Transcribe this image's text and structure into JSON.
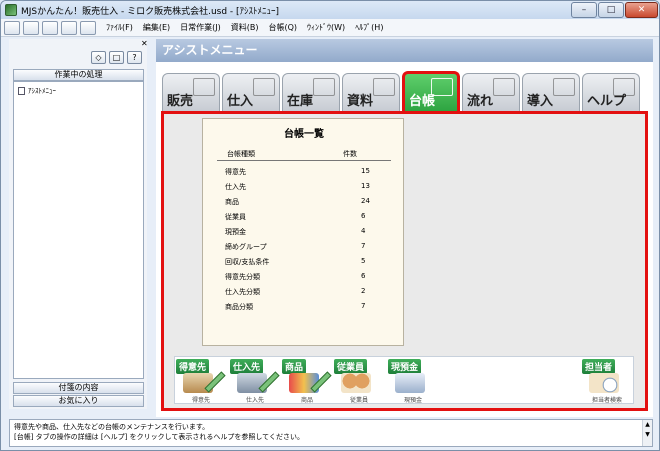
{
  "window": {
    "title": "MJSかんたん！販売仕入 - ミロク販売株式会社.usd - [ｱｼｽﾄﾒﾆｭｰ]",
    "min": "–",
    "max": "□",
    "close": "✕"
  },
  "menubar": {
    "items": [
      "ﾌｧｲﾙ(F)",
      "編集(E)",
      "日常作業(J)",
      "資料(B)",
      "台帳(Q)",
      "ｳｨﾝﾄﾞｳ(W)",
      "ﾍﾙﾌﾟ(H)"
    ],
    "mdi": [
      "_",
      "▫",
      "✕"
    ]
  },
  "left_panel": {
    "close": "✕",
    "tools": [
      "◇",
      "□",
      "?"
    ],
    "header": "作業中の処理",
    "tree_item": "ｱｼｽﾄﾒﾆｭｰ",
    "footer1": "付箋の内容",
    "footer2": "お気に入り"
  },
  "main": {
    "title": "アシストメニュー"
  },
  "tabs": [
    {
      "label": "販売"
    },
    {
      "label": "仕入"
    },
    {
      "label": "在庫"
    },
    {
      "label": "資料"
    },
    {
      "label": "台帳"
    },
    {
      "label": "流れ"
    },
    {
      "label": "導入"
    },
    {
      "label": "ヘルプ"
    }
  ],
  "ledger": {
    "title": "台帳一覧",
    "col_name": "台帳種類",
    "col_count": "件数",
    "rows": [
      {
        "name": "得意先",
        "count": "15"
      },
      {
        "name": "仕入先",
        "count": "13"
      },
      {
        "name": "商品",
        "count": "24"
      },
      {
        "name": "従業員",
        "count": "6"
      },
      {
        "name": "現預金",
        "count": "4"
      },
      {
        "name": "締めグループ",
        "count": "7"
      },
      {
        "name": "回収/支払条件",
        "count": "5"
      },
      {
        "name": "得意先分類",
        "count": "6"
      },
      {
        "name": "仕入先分類",
        "count": "2"
      },
      {
        "name": "商品分類",
        "count": "7"
      }
    ]
  },
  "bottom": {
    "items": [
      {
        "label": "得意先",
        "caption": "得意先"
      },
      {
        "label": "仕入先",
        "caption": "仕入先"
      },
      {
        "label": "商品",
        "caption": "商品"
      },
      {
        "label": "従業員",
        "caption": "従業員"
      },
      {
        "label": "現預金",
        "caption": "現預金"
      },
      {
        "label": "担当者",
        "caption": "担当者検索"
      }
    ]
  },
  "status": {
    "line1": "得意先や商品、仕入先などの台帳のメンテナンスを行います。",
    "line2": "[台帳] タブの操作の詳細は [ヘルプ] をクリックして表示されるヘルプを参照してください。"
  },
  "colors": {
    "active_tab": "#2ea441",
    "highlight": "#e31010",
    "title_bar": "#a3b8d6"
  }
}
